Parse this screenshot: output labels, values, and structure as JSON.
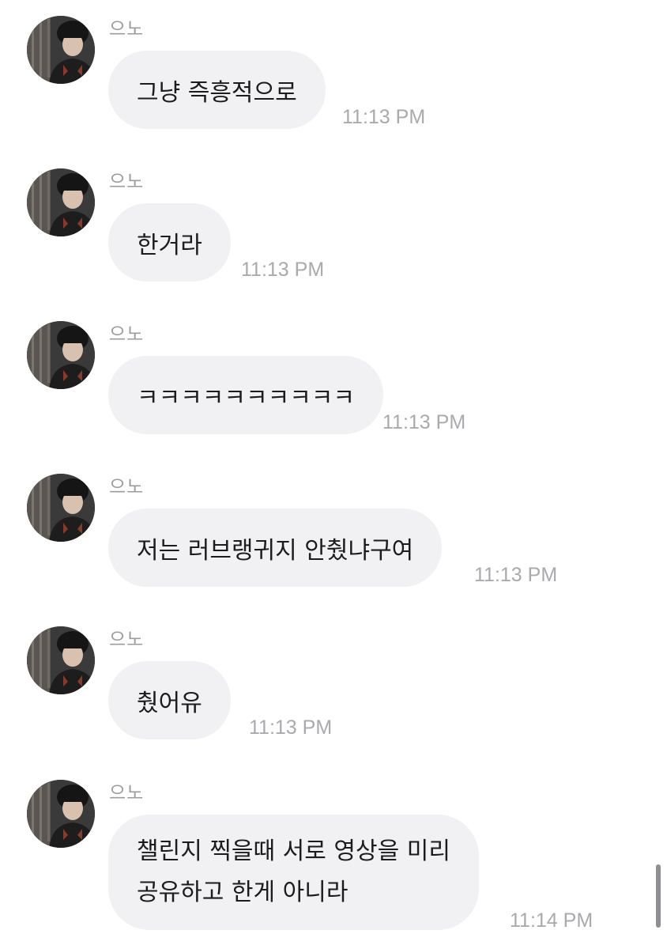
{
  "messages": [
    {
      "sender": "으노",
      "lines": [
        "그냥 즉흥적으로"
      ],
      "time": "11:13 PM"
    },
    {
      "sender": "으노",
      "lines": [
        "한거라"
      ],
      "time": "11:13 PM"
    },
    {
      "sender": "으노",
      "lines": [
        "ㅋㅋㅋㅋㅋㅋㅋㅋㅋㅋ"
      ],
      "time": "11:13 PM"
    },
    {
      "sender": "으노",
      "lines": [
        "저는 러브랭귀지 안췄냐구여"
      ],
      "time": "11:13 PM"
    },
    {
      "sender": "으노",
      "lines": [
        "췄어유"
      ],
      "time": "11:13 PM"
    },
    {
      "sender": "으노",
      "lines": [
        "챌린지 찍을때 서로 영상을 미리",
        "공유하고 한게 아니라"
      ],
      "time": "11:14 PM"
    }
  ],
  "colors": {
    "bubble": "#f1f1f3",
    "bubble_text": "#1c1c1e",
    "sender_text": "#9b9ba0",
    "time_text": "#a9a9ae"
  },
  "icons": {
    "avatar": "profile-photo"
  }
}
